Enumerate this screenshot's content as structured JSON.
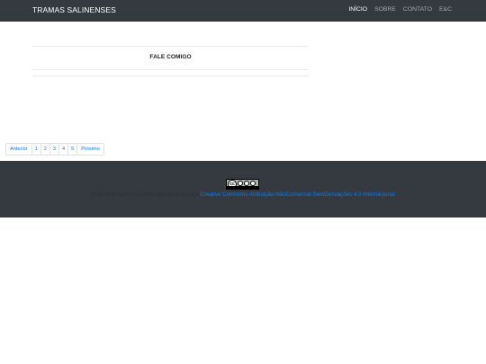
{
  "navbar": {
    "brand": "TRAMAS SALINENSES",
    "links": [
      "INÍCIO",
      "SOBRE",
      "CONTATO",
      "E&C"
    ]
  },
  "main": {
    "post_title": "FALE COMIGO"
  },
  "pagination": {
    "prev": "Anterior",
    "pages": [
      "1",
      "2",
      "3",
      "4",
      "5"
    ],
    "next": "Próximo"
  },
  "footer": {
    "license_text": "Esta obra está licenciada com uma Licença",
    "license_link": "Creative Commons Atribuição-NãoComercial-SemDerivações 4.0 Internacional",
    "badge_label": "cc"
  },
  "colors": {
    "navbar_bg": "#343a40",
    "link": "#007bff"
  }
}
